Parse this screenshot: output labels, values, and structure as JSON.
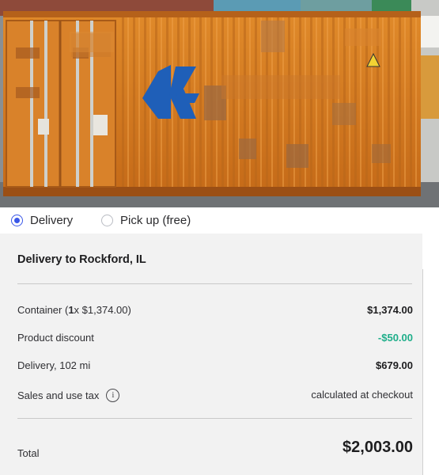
{
  "delivery_options": {
    "selected": "delivery",
    "items": [
      {
        "id": "delivery",
        "label": "Delivery"
      },
      {
        "id": "pickup",
        "label": "Pick up (free)"
      }
    ]
  },
  "summary": {
    "title": "Delivery to Rockford, IL",
    "container": {
      "prefix": "Container (",
      "qty": "1",
      "suffix": " x $1,374.00)",
      "value": "$1,374.00"
    },
    "discount": {
      "label": "Product discount",
      "value": "-$50.00"
    },
    "delivery": {
      "label": "Delivery, 102 mi",
      "value": "$679.00"
    },
    "tax": {
      "label": "Sales and use tax",
      "value": "calculated at checkout"
    },
    "total": {
      "label": "Total",
      "value": "$2,003.00"
    }
  },
  "colors": {
    "accent": "#3a57e8",
    "discount": "#1fae8a",
    "card_bg": "#f2f2f2"
  },
  "icons": {
    "info": "info-circle-icon"
  }
}
